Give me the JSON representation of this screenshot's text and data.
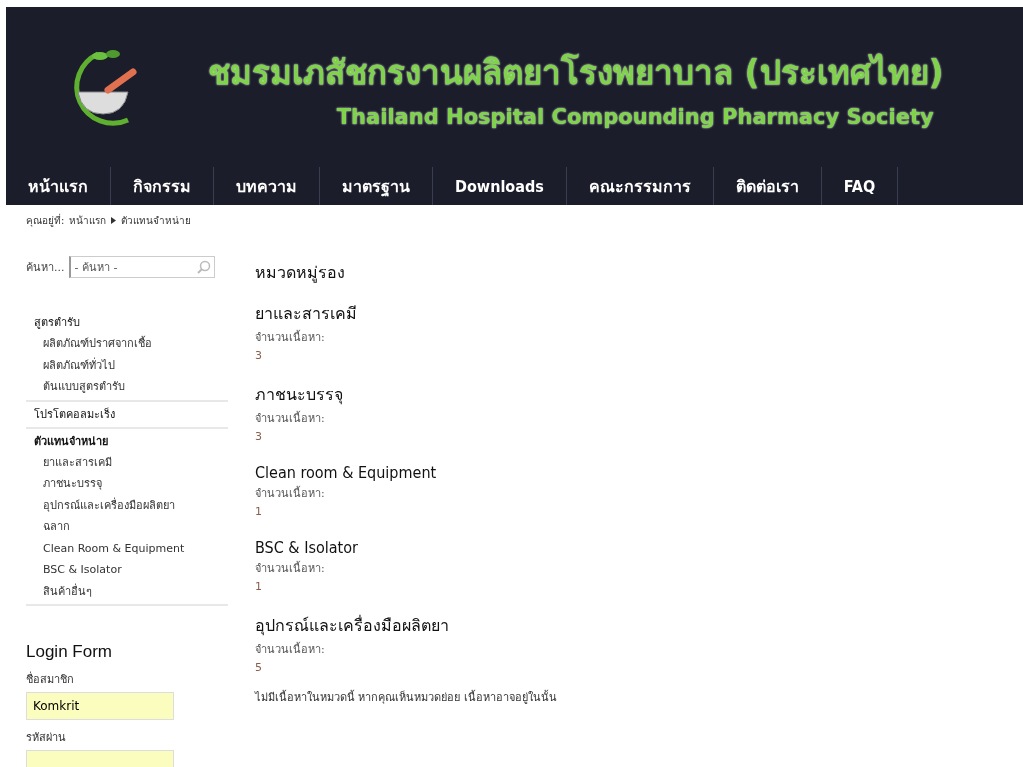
{
  "header": {
    "title_th": "ชมรมเภสัชกรงานผลิตยาโรงพยาบาล (ประเทศไทย)",
    "title_en": "Thailand Hospital Compounding Pharmacy Society"
  },
  "nav": [
    {
      "label": "หน้าแรก",
      "selected": false
    },
    {
      "label": "กิจกรรม",
      "selected": false
    },
    {
      "label": "บทความ",
      "selected": false
    },
    {
      "label": "มาตรฐาน",
      "selected": false
    },
    {
      "label": "Downloads",
      "selected": false
    },
    {
      "label": "คณะกรรมการ",
      "selected": false
    },
    {
      "label": "ติดต่อเรา",
      "selected": false
    },
    {
      "label": "FAQ",
      "selected": false
    }
  ],
  "breadcrumb": {
    "prefix": "คุณอยู่ที่:",
    "items": [
      "หน้าแรก",
      "ตัวแทนจำหน่าย"
    ]
  },
  "search": {
    "label": "ค้นหา...",
    "placeholder": "- ค้นหา -"
  },
  "sidebar": {
    "groups": [
      {
        "label": "สูตรตำรับ",
        "selected": false,
        "children": [
          {
            "label": "ผลิตภัณฑ์ปราศจากเชื้อ"
          },
          {
            "label": "ผลิตภัณฑ์ทั่วไป"
          },
          {
            "label": "ต้นแบบสูตรตำรับ"
          }
        ]
      },
      {
        "label": "โปรโตคอลมะเร็ง",
        "selected": false
      },
      {
        "label": "ตัวแทนจำหน่าย",
        "selected": true,
        "children": [
          {
            "label": "ยาและสารเคมี"
          },
          {
            "label": "ภาชนะบรรจุ"
          },
          {
            "label": "อุปกรณ์และเครื่องมือผลิตยา"
          },
          {
            "label": "ฉลาก"
          },
          {
            "label": "Clean Room & Equipment"
          },
          {
            "label": "BSC & Isolator"
          },
          {
            "label": "สินค้าอื่นๆ"
          }
        ]
      }
    ]
  },
  "login": {
    "title": "Login Form",
    "username_label": "ชื่อสมาชิก",
    "username_value": "Komkrit",
    "password_label": "รหัสผ่าน"
  },
  "main": {
    "heading": "หมวดหมู่รอง",
    "subcategories": [
      {
        "title": "ยาและสารเคมี",
        "count_label": "จำนวนเนื้อหา:",
        "count": "3"
      },
      {
        "title": "ภาชนะบรรจุ",
        "count_label": "จำนวนเนื้อหา:",
        "count": "3"
      },
      {
        "title": "Clean room & Equipment",
        "count_label": "จำนวนเนื้อหา:",
        "count": "1"
      },
      {
        "title": "BSC & Isolator",
        "count_label": "จำนวนเนื้อหา:",
        "count": "1"
      },
      {
        "title": "อุปกรณ์และเครื่องมือผลิตยา",
        "count_label": "จำนวนเนื้อหา:",
        "count": "5"
      }
    ],
    "note": "ไม่มีเนื้อหาในหมวดนี้ หากคุณเห็นหมวดย่อย เนื้อหาอาจอยู่ในนั้น"
  }
}
